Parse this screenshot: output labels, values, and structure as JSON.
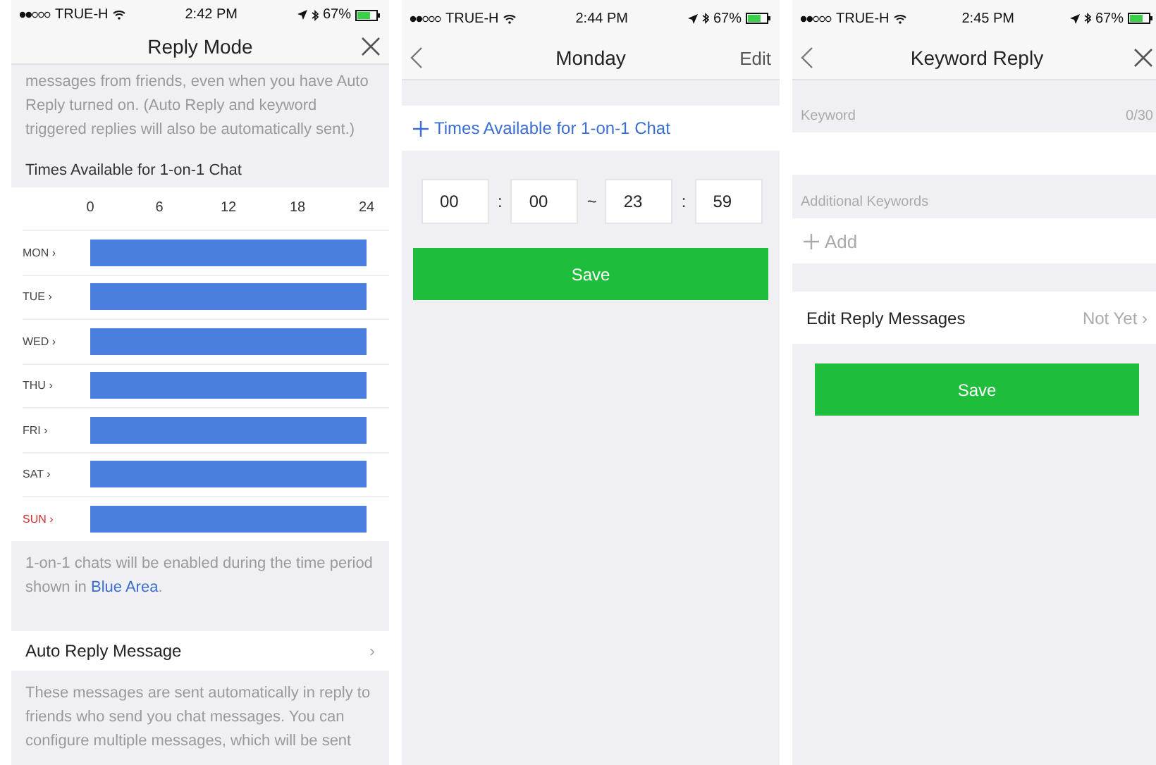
{
  "screens": [
    {
      "kind": "reply_mode",
      "status": {
        "carrier": "TRUE-H",
        "time": "2:42 PM",
        "battery": "67%"
      },
      "nav": {
        "title": "Reply Mode",
        "back": false,
        "close": true
      },
      "intro": "messages from friends, even when you have Auto Reply turned on. (Auto Reply and keyword triggered replies will also be automatically sent.)",
      "schedule": {
        "title": "Times Available for 1-on-1 Chat",
        "day_chevron": "›",
        "days": [
          {
            "holiday": false
          },
          {
            "holiday": false
          },
          {
            "holiday": false
          },
          {
            "holiday": false
          },
          {
            "holiday": false
          },
          {
            "holiday": false
          },
          {
            "holiday": true
          }
        ],
        "chart_data": {
          "type": "bar",
          "orientation": "horizontal",
          "categories": [
            "MON",
            "TUE",
            "WED",
            "THU",
            "FRI",
            "SAT",
            "SUN"
          ],
          "xlim": [
            0,
            24
          ],
          "xticks": [
            0,
            6,
            12,
            18,
            24
          ],
          "series": [
            {
              "color": "#4a7fe0",
              "values": [
                24,
                24,
                24,
                24,
                24,
                24,
                24
              ]
            }
          ]
        },
        "note": "1-on-1 chats will be enabled during the time period shown in",
        "note_link": "Blue Area",
        "note_end": "."
      },
      "auto_reply": {
        "label": "Auto Reply Message",
        "chevron": "›",
        "description": "These messages are sent automatically in reply to friends who send you chat messages. You can configure multiple messages, which will be sent"
      }
    },
    {
      "kind": "day_edit",
      "status": {
        "carrier": "TRUE-H",
        "time": "2:44 PM",
        "battery": "67%"
      },
      "nav": {
        "title": "Monday",
        "back": true,
        "right_text": "Edit",
        "close": false
      },
      "add_label": "Times Available for 1-on-1 Chat",
      "time_range": {
        "start_hour": "00",
        "colon": ":",
        "start_minute": "00",
        "separator": "~",
        "end_hour": "23",
        "end_minute": "59"
      },
      "save": "Save"
    },
    {
      "kind": "keyword_reply",
      "status": {
        "carrier": "TRUE-H",
        "time": "2:45 PM",
        "battery": "67%"
      },
      "nav": {
        "title": "Keyword Reply",
        "back": true,
        "close": true
      },
      "keyword_label": "Keyword",
      "keyword_count": "0/30",
      "additional_label": "Additional Keywords",
      "add_placeholder": "Add",
      "edit_row": {
        "label": "Edit Reply Messages",
        "value": "Not Yet",
        "chevron": "›"
      },
      "save": "Save"
    }
  ]
}
